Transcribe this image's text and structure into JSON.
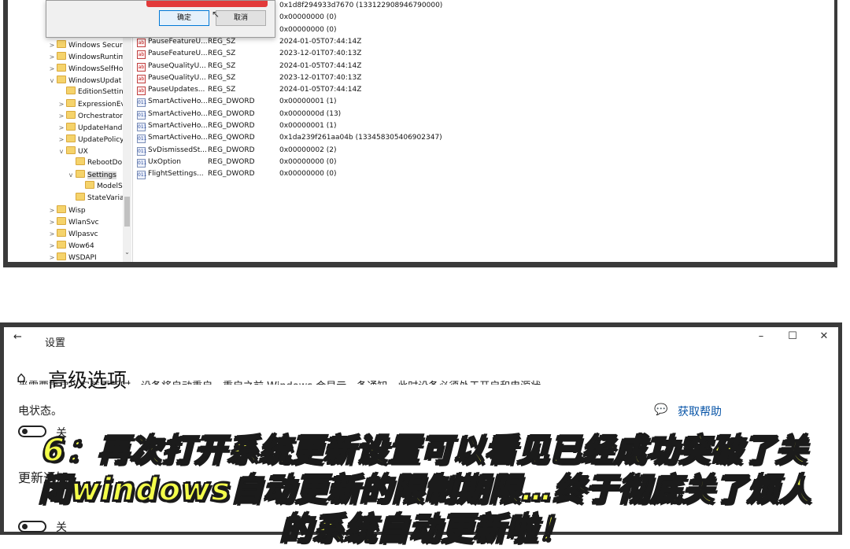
{
  "dialog": {
    "ok_label": "确定",
    "cancel_label": "取消"
  },
  "tree": {
    "items": [
      {
        "label": "Windows Securi",
        "chev": ">",
        "indent": 0
      },
      {
        "label": "WindowsRuntim",
        "chev": ">",
        "indent": 0
      },
      {
        "label": "WindowsSelfHo",
        "chev": ">",
        "indent": 0
      },
      {
        "label": "WindowsUpdat",
        "chev": "v",
        "indent": 0
      },
      {
        "label": "EditionSetting",
        "chev": "",
        "indent": 1
      },
      {
        "label": "ExpressionEv",
        "chev": ">",
        "indent": 1
      },
      {
        "label": "Orchestrator",
        "chev": ">",
        "indent": 1
      },
      {
        "label": "UpdateHand",
        "chev": ">",
        "indent": 1
      },
      {
        "label": "UpdatePolicy",
        "chev": ">",
        "indent": 1
      },
      {
        "label": "UX",
        "chev": "v",
        "indent": 1
      },
      {
        "label": "RebootDo",
        "chev": "",
        "indent": 2
      },
      {
        "label": "Settings",
        "chev": "v",
        "indent": 2,
        "selected": true
      },
      {
        "label": "ModelS",
        "chev": "",
        "indent": 3
      },
      {
        "label": "StateVaria",
        "chev": "",
        "indent": 2
      },
      {
        "label": "Wisp",
        "chev": ">",
        "indent": 0
      },
      {
        "label": "WlanSvc",
        "chev": ">",
        "indent": 0
      },
      {
        "label": "Wlpasvc",
        "chev": ">",
        "indent": 0
      },
      {
        "label": "Wow64",
        "chev": ">",
        "indent": 0
      },
      {
        "label": "WSDAPI",
        "chev": ">",
        "indent": 0
      }
    ]
  },
  "values": {
    "rows": [
      {
        "icon": "dword",
        "name": "",
        "type": "",
        "data": "0x1d8f294933d7670 (133122908946790000)"
      },
      {
        "icon": "dword",
        "name": "",
        "type": "",
        "data": "0x00000000 (0)"
      },
      {
        "icon": "dword",
        "name": "",
        "type": "",
        "data": "0x00000000 (0)"
      },
      {
        "icon": "sz",
        "name": "PauseFeatureU...",
        "type": "REG_SZ",
        "data": "2024-01-05T07:44:14Z"
      },
      {
        "icon": "sz",
        "name": "PauseFeatureU...",
        "type": "REG_SZ",
        "data": "2023-12-01T07:40:13Z"
      },
      {
        "icon": "sz",
        "name": "PauseQualityU...",
        "type": "REG_SZ",
        "data": "2024-01-05T07:44:14Z"
      },
      {
        "icon": "sz",
        "name": "PauseQualityU...",
        "type": "REG_SZ",
        "data": "2023-12-01T07:40:13Z"
      },
      {
        "icon": "sz",
        "name": "PauseUpdates...",
        "type": "REG_SZ",
        "data": "2024-01-05T07:44:14Z"
      },
      {
        "icon": "dword",
        "name": "SmartActiveHo...",
        "type": "REG_DWORD",
        "data": "0x00000001 (1)"
      },
      {
        "icon": "dword",
        "name": "SmartActiveHo...",
        "type": "REG_DWORD",
        "data": "0x0000000d (13)"
      },
      {
        "icon": "dword",
        "name": "SmartActiveHo...",
        "type": "REG_DWORD",
        "data": "0x00000001 (1)"
      },
      {
        "icon": "dword",
        "name": "SmartActiveHo...",
        "type": "REG_QWORD",
        "data": "0x1da239f261aa04b (133458305406902347)"
      },
      {
        "icon": "dword",
        "name": "SvDismissedSt...",
        "type": "REG_DWORD",
        "data": "0x00000002 (2)"
      },
      {
        "icon": "dword",
        "name": "UxOption",
        "type": "REG_DWORD",
        "data": "0x00000000 (0)"
      },
      {
        "icon": "dword",
        "name": "FlightSettings...",
        "type": "REG_DWORD",
        "data": "0x00000000 (0)"
      }
    ]
  },
  "settings": {
    "app_title": "设置",
    "page_title": "高级选项",
    "clipped_text": "当需要重启以安装更新时，设备将自动重启。重启之前 Windows 会显示一条通知，此时设备必须处于开启和电源状",
    "desc_text": "电状态。",
    "help_label": "获取帮助",
    "toggle1_label": "关",
    "section_heading": "更新通知",
    "toggle2_label": "关",
    "window_controls": {
      "minimize": "–",
      "maximize": "☐",
      "close": "✕"
    },
    "back": "←",
    "home": "⌂"
  },
  "caption": {
    "line1": "6：再次打开系统更新设置可以看见已经成功突破了关",
    "line2": "闭windows自动更新的限制期限…终于彻底关了烦人",
    "line3": "的系统自动更新啦！"
  },
  "colors": {
    "caption_fill": "#f4ff4a",
    "caption_stroke": "#1b1b1b",
    "link": "#0a56a8",
    "dialog_accent": "#e23a3a"
  }
}
